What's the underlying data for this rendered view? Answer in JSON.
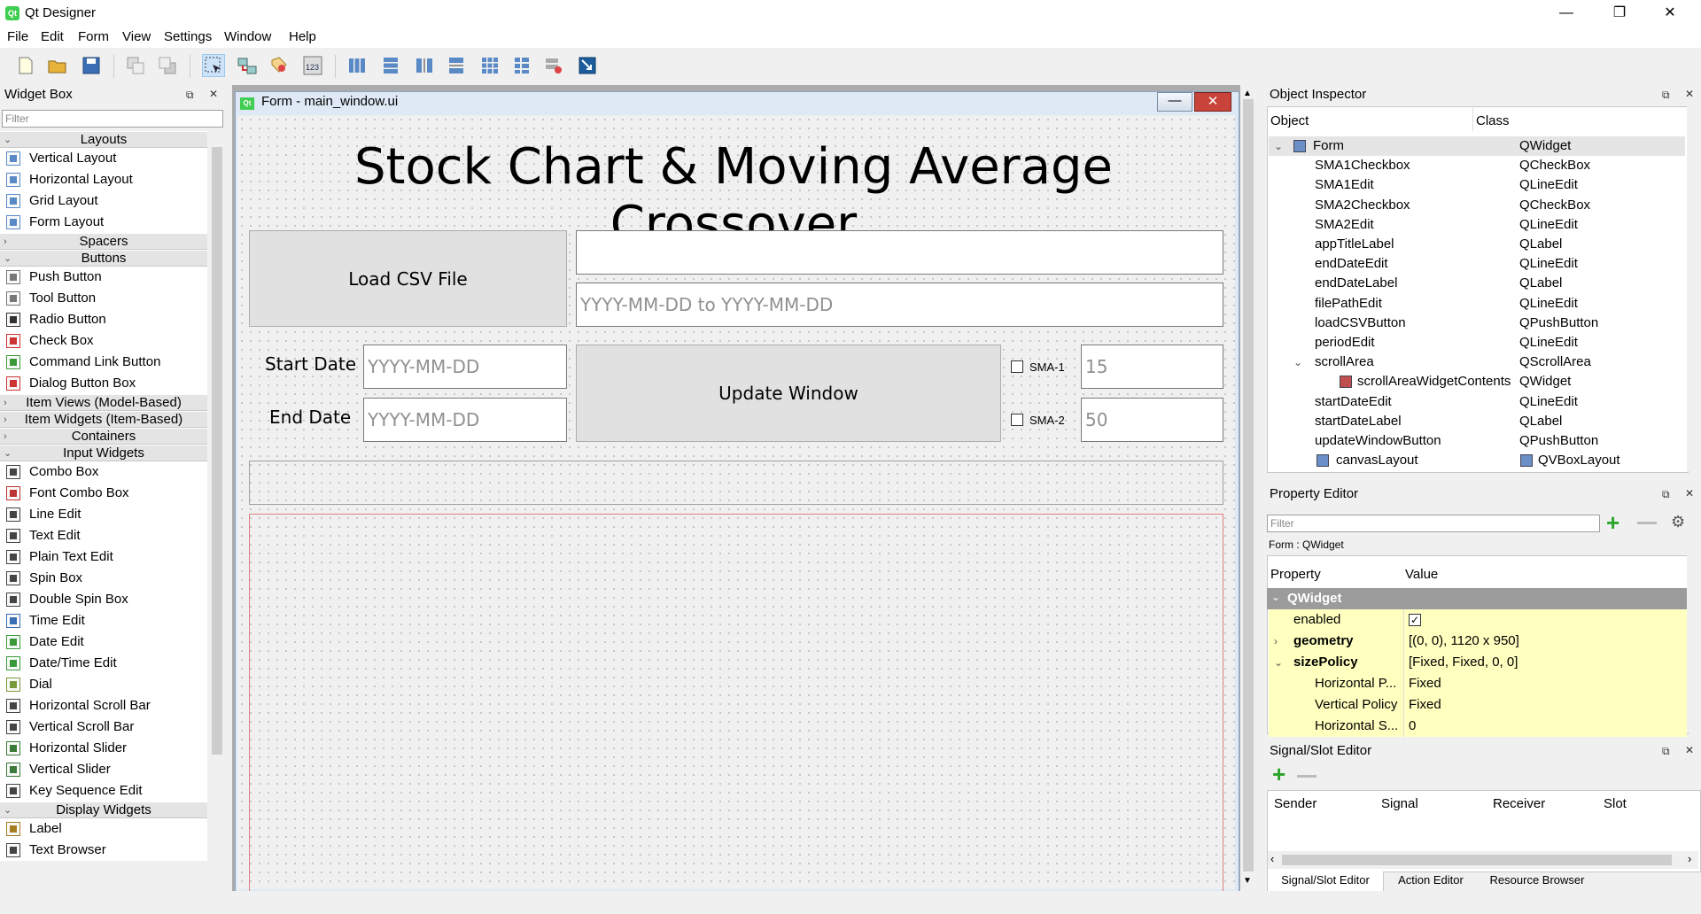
{
  "window": {
    "title": "Qt Designer",
    "minimize": "—",
    "maximize": "❐",
    "close": "✕"
  },
  "menu": [
    "File",
    "Edit",
    "Form",
    "View",
    "Settings",
    "Window",
    "Help"
  ],
  "widget_box": {
    "title": "Widget Box",
    "filter_placeholder": "Filter",
    "categories": [
      {
        "label": "Layouts",
        "items": [
          "Vertical Layout",
          "Horizontal Layout",
          "Grid Layout",
          "Form Layout"
        ]
      },
      {
        "label": "Spacers",
        "items": []
      },
      {
        "label": "Buttons",
        "items": [
          "Push Button",
          "Tool Button",
          "Radio Button",
          "Check Box",
          "Command Link Button",
          "Dialog Button Box"
        ]
      },
      {
        "label": "Item Views (Model-Based)",
        "items": []
      },
      {
        "label": "Item Widgets (Item-Based)",
        "items": []
      },
      {
        "label": "Containers",
        "items": []
      },
      {
        "label": "Input Widgets",
        "items": [
          "Combo Box",
          "Font Combo Box",
          "Line Edit",
          "Text Edit",
          "Plain Text Edit",
          "Spin Box",
          "Double Spin Box",
          "Time Edit",
          "Date Edit",
          "Date/Time Edit",
          "Dial",
          "Horizontal Scroll Bar",
          "Vertical Scroll Bar",
          "Horizontal Slider",
          "Vertical Slider",
          "Key Sequence Edit"
        ]
      },
      {
        "label": "Display Widgets",
        "items": [
          "Label",
          "Text Browser"
        ]
      }
    ]
  },
  "form": {
    "window_title": "Form - main_window.ui",
    "app_title": "Stock Chart & Moving Average Crossover",
    "load_button": "Load CSV File",
    "date_range_placeholder": "YYYY-MM-DD to YYYY-MM-DD",
    "start_label": "Start Date",
    "end_label": "End Date",
    "date_placeholder": "YYYY-MM-DD",
    "update_button": "Update Window",
    "sma1_label": "SMA-1",
    "sma2_label": "SMA-2",
    "sma1_value": "15",
    "sma2_value": "50"
  },
  "object_inspector": {
    "title": "Object Inspector",
    "col_object": "Object",
    "col_class": "Class",
    "rows": [
      {
        "object": "Form",
        "class": "QWidget"
      },
      {
        "object": "SMA1Checkbox",
        "class": "QCheckBox"
      },
      {
        "object": "SMA1Edit",
        "class": "QLineEdit"
      },
      {
        "object": "SMA2Checkbox",
        "class": "QCheckBox"
      },
      {
        "object": "SMA2Edit",
        "class": "QLineEdit"
      },
      {
        "object": "appTitleLabel",
        "class": "QLabel"
      },
      {
        "object": "endDateEdit",
        "class": "QLineEdit"
      },
      {
        "object": "endDateLabel",
        "class": "QLabel"
      },
      {
        "object": "filePathEdit",
        "class": "QLineEdit"
      },
      {
        "object": "loadCSVButton",
        "class": "QPushButton"
      },
      {
        "object": "periodEdit",
        "class": "QLineEdit"
      },
      {
        "object": "scrollArea",
        "class": "QScrollArea"
      },
      {
        "object": "scrollAreaWidgetContents",
        "class": "QWidget"
      },
      {
        "object": "startDateEdit",
        "class": "QLineEdit"
      },
      {
        "object": "startDateLabel",
        "class": "QLabel"
      },
      {
        "object": "updateWindowButton",
        "class": "QPushButton"
      },
      {
        "object": "canvasLayout",
        "class": "QVBoxLayout"
      }
    ]
  },
  "property_editor": {
    "title": "Property Editor",
    "filter_placeholder": "Filter",
    "context": "Form : QWidget",
    "col_property": "Property",
    "col_value": "Value",
    "group": "QWidget",
    "rows": [
      {
        "property": "enabled",
        "value": ""
      },
      {
        "property": "geometry",
        "value": "[(0, 0), 1120 x 950]"
      },
      {
        "property": "sizePolicy",
        "value": "[Fixed, Fixed, 0, 0]"
      },
      {
        "property": "Horizontal P...",
        "value": "Fixed"
      },
      {
        "property": "Vertical Policy",
        "value": "Fixed"
      },
      {
        "property": "Horizontal S...",
        "value": "0"
      }
    ]
  },
  "signal_slot": {
    "title": "Signal/Slot Editor",
    "columns": [
      "Sender",
      "Signal",
      "Receiver",
      "Slot"
    ],
    "tabs": [
      "Signal/Slot Editor",
      "Action Editor",
      "Resource Browser"
    ]
  }
}
